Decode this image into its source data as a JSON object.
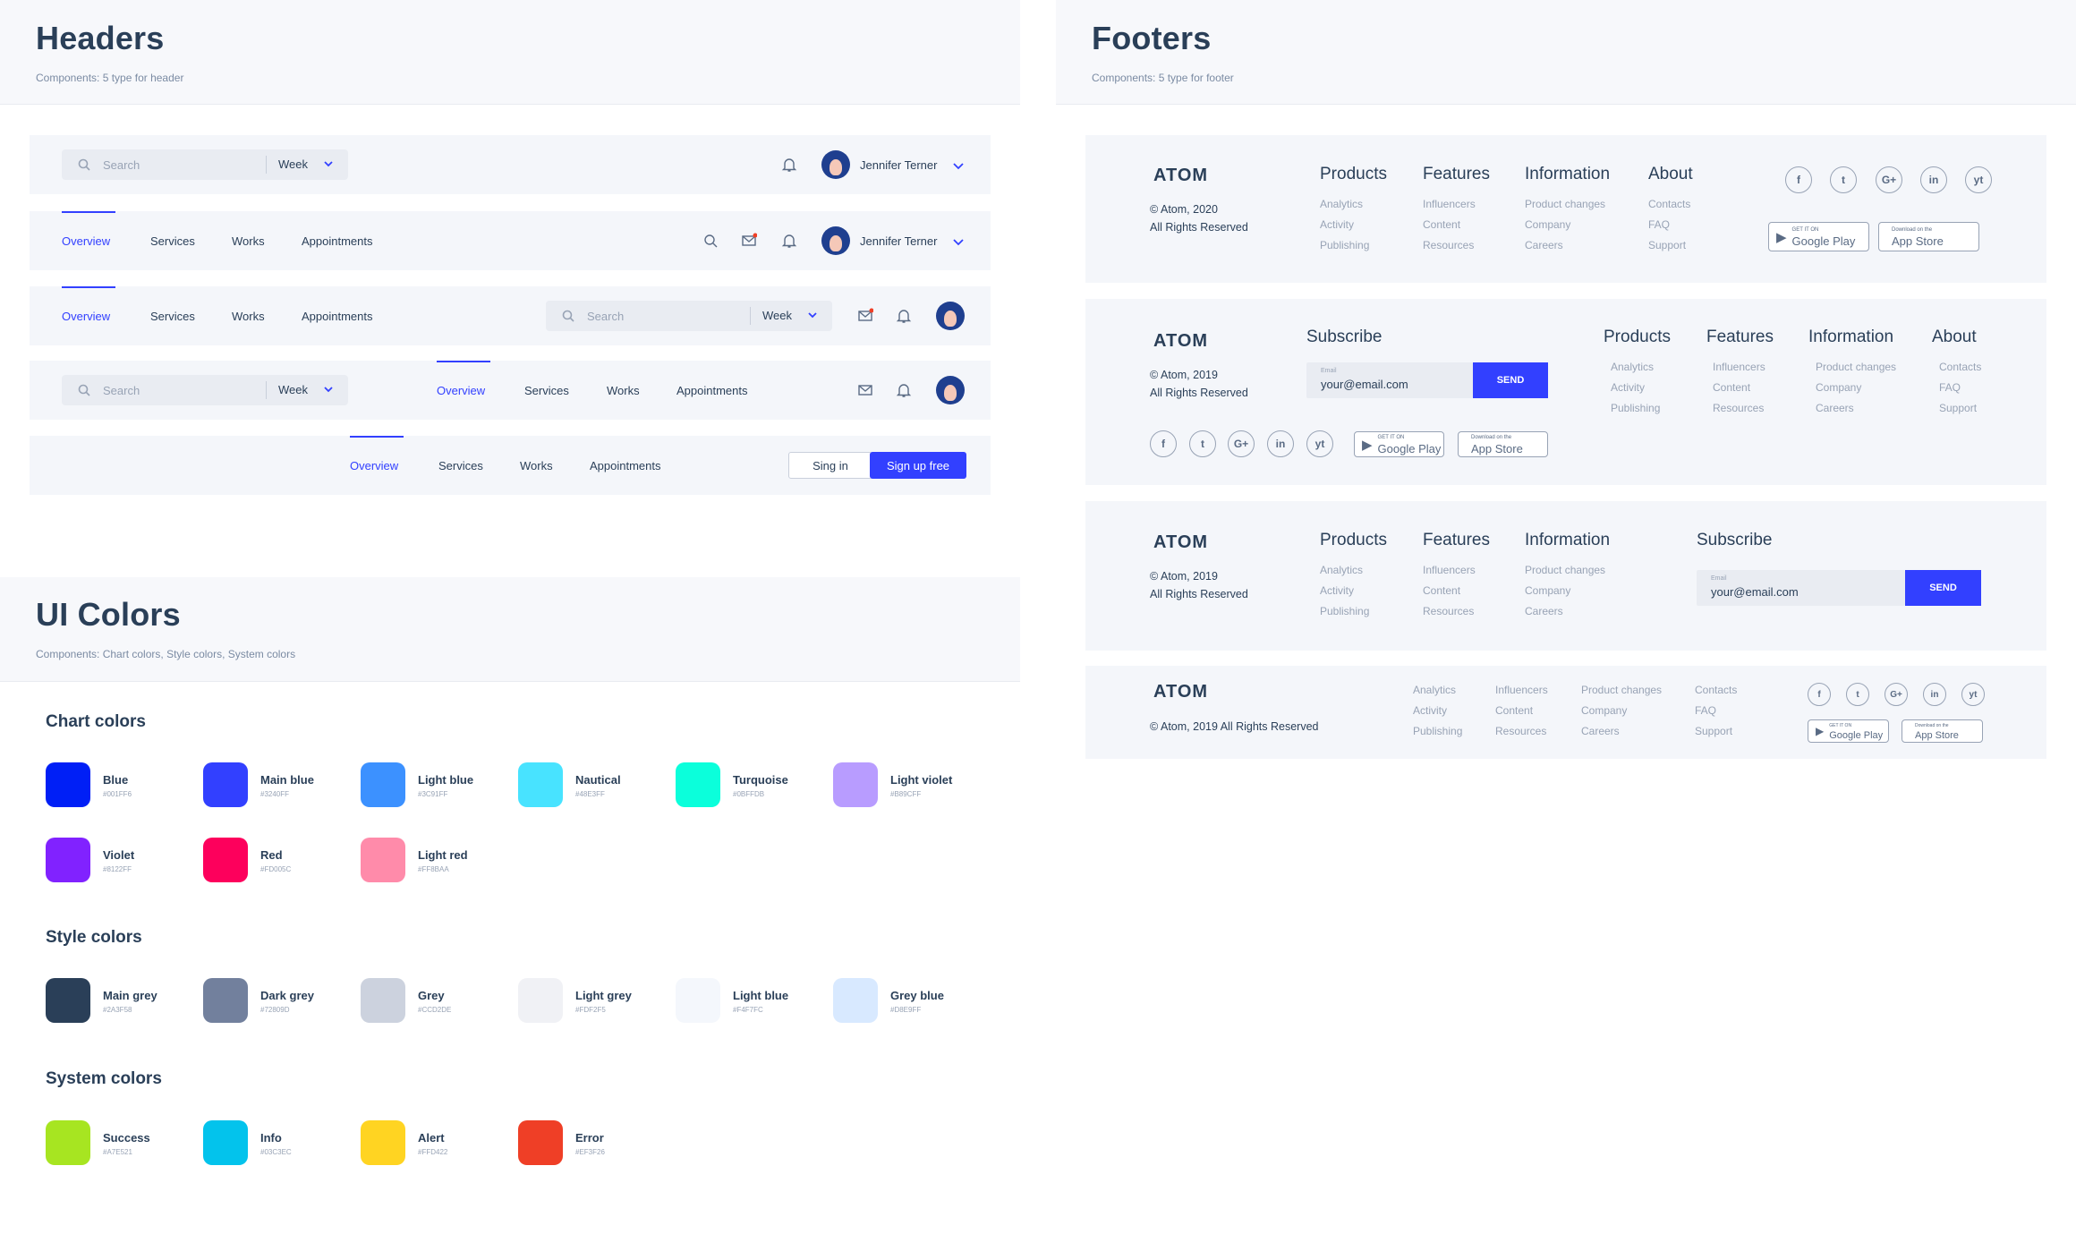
{
  "headers_panel": {
    "title": "Headers",
    "caption": "Components: 5 type for header"
  },
  "footers_panel": {
    "title": "Footers",
    "caption": "Components: 5 type for footer"
  },
  "colors_panel": {
    "title": "UI Colors",
    "caption": "Components: Chart colors, Style colors, System colors"
  },
  "header": {
    "search_placeholder": "Search",
    "week": "Week",
    "user_name": "Jennifer Terner",
    "nav": [
      "Overview",
      "Services",
      "Works",
      "Appointments"
    ],
    "signin": "Sing in",
    "signup": "Sign up free"
  },
  "footer": {
    "brand": "ATOM",
    "copy_2020": "© Atom, 2020",
    "copy_2019": "© Atom, 2019",
    "rights": "All Rights Reserved",
    "copy_inline": "© Atom, 2019 All Rights Reserved",
    "subscribe": "Subscribe",
    "email_label": "Email",
    "email_value": "your@email.com",
    "send": "SEND",
    "columns": [
      {
        "title": "Products",
        "items": [
          "Analytics",
          "Activity",
          "Publishing"
        ]
      },
      {
        "title": "Features",
        "items": [
          "Influencers",
          "Content",
          "Resources"
        ]
      },
      {
        "title": "Information",
        "items": [
          "Product changes",
          "Company",
          "Careers"
        ]
      },
      {
        "title": "About",
        "items": [
          "Contacts",
          "FAQ",
          "Support"
        ]
      }
    ],
    "social": [
      "f",
      "t",
      "G+",
      "in",
      "yt"
    ],
    "google_small": "GET IT ON",
    "google_big": "Google Play",
    "apple_small": "Download on the",
    "apple_big": "App Store"
  },
  "colors": {
    "chart_title": "Chart colors",
    "style_title": "Style colors",
    "system_title": "System colors",
    "chart": [
      {
        "name": "Blue",
        "hex": "#001FF6",
        "color": "#001FF6"
      },
      {
        "name": "Main blue",
        "hex": "#3240FF",
        "color": "#3240FF"
      },
      {
        "name": "Light blue",
        "hex": "#3C91FF",
        "color": "#3C91FF"
      },
      {
        "name": "Nautical",
        "hex": "#48E3FF",
        "color": "#48E3FF"
      },
      {
        "name": "Turquoise",
        "hex": "#0BFFDB",
        "color": "#0BFFDB"
      },
      {
        "name": "Light violet",
        "hex": "#B89CFF",
        "color": "#B89CFF"
      },
      {
        "name": "Violet",
        "hex": "#8122FF",
        "color": "#8122FF"
      },
      {
        "name": "Red",
        "hex": "#FD005C",
        "color": "#FD005C"
      },
      {
        "name": "Light red",
        "hex": "#FF8BAA",
        "color": "#FF8BAA"
      }
    ],
    "style": [
      {
        "name": "Main grey",
        "hex": "#2A3F58",
        "color": "#2A3F58"
      },
      {
        "name": "Dark grey",
        "hex": "#72809D",
        "color": "#72809D"
      },
      {
        "name": "Grey",
        "hex": "#CCD2DE",
        "color": "#CCD2DE"
      },
      {
        "name": "Light grey",
        "hex": "#FDF2F5",
        "color": "#F0F1F5"
      },
      {
        "name": "Light blue",
        "hex": "#F4F7FC",
        "color": "#F4F7FC"
      },
      {
        "name": "Grey blue",
        "hex": "#D8E9FF",
        "color": "#D8E9FF"
      }
    ],
    "system": [
      {
        "name": "Success",
        "hex": "#A7E521",
        "color": "#A7E521"
      },
      {
        "name": "Info",
        "hex": "#03C3EC",
        "color": "#03C3EC"
      },
      {
        "name": "Alert",
        "hex": "#FFD422",
        "color": "#FFD422"
      },
      {
        "name": "Error",
        "hex": "#EF3F26",
        "color": "#EF3F26"
      }
    ]
  }
}
